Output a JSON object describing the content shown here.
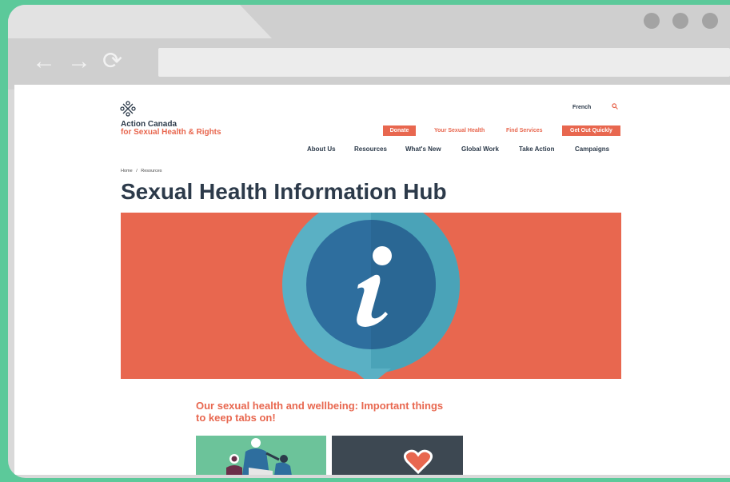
{
  "browser": {
    "nav_back_icon": "arrow-left-icon",
    "nav_forward_icon": "arrow-right-icon",
    "reload_icon": "reload-icon",
    "url": ""
  },
  "site": {
    "org_name_line1": "Action Canada",
    "org_name_line2": "for Sexual Health & Rights",
    "language_link": "French"
  },
  "utility_nav": {
    "donate": "Donate",
    "your_sexual_health": "Your Sexual Health",
    "find_services": "Find Services",
    "get_out_quickly": "Get Out Quickly"
  },
  "main_nav": [
    "About Us",
    "Resources",
    "What's New",
    "Global Work",
    "Take Action",
    "Campaigns"
  ],
  "breadcrumb": {
    "home": "Home",
    "separator": "/",
    "current": "Resources"
  },
  "page": {
    "title": "Sexual Health Information Hub",
    "subtitle": "Our sexual health and wellbeing: Important things to keep tabs on!"
  },
  "colors": {
    "accent": "#e8674f",
    "navy": "#2c3a4a",
    "hero_teal": "#5ab0c4",
    "hero_blue": "#2e6e9e",
    "frame_green": "#5cc99a"
  }
}
